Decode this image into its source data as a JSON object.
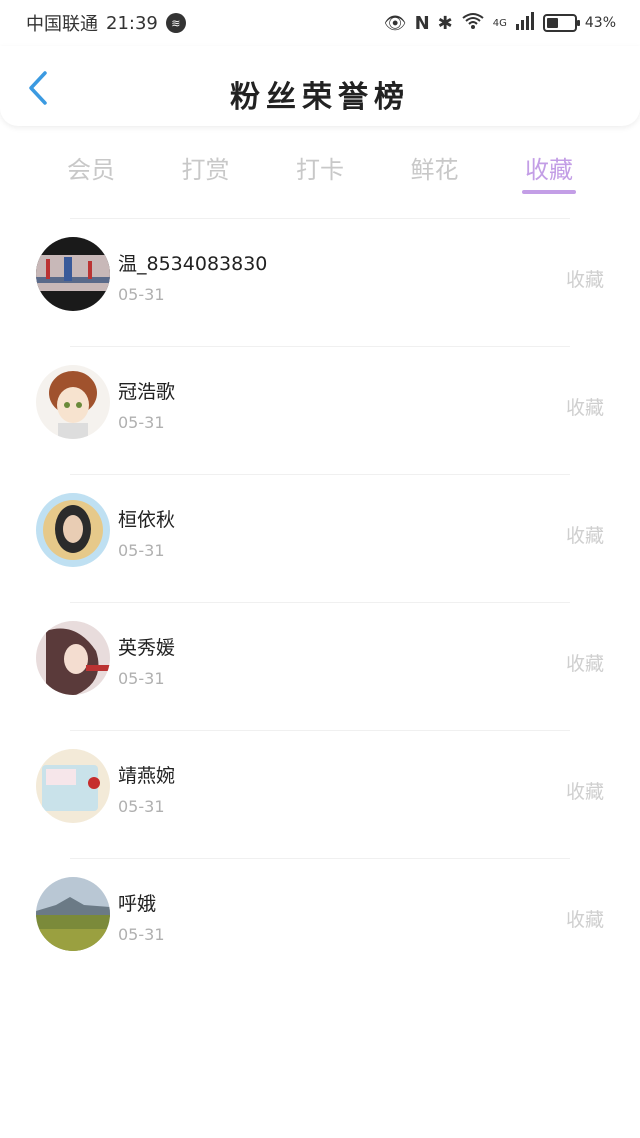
{
  "status_bar": {
    "carrier": "中国联通",
    "time": "21:39",
    "network": "4G",
    "battery": "43%",
    "battery_level": 0.43
  },
  "header": {
    "title": "粉丝荣誉榜"
  },
  "tabs": [
    {
      "label": "会员",
      "active": false
    },
    {
      "label": "打赏",
      "active": false
    },
    {
      "label": "打卡",
      "active": false
    },
    {
      "label": "鲜花",
      "active": false
    },
    {
      "label": "收藏",
      "active": true
    }
  ],
  "list": [
    {
      "name": "温_8534083830",
      "date": "05-31",
      "action": "收藏"
    },
    {
      "name": "冠浩歌",
      "date": "05-31",
      "action": "收藏"
    },
    {
      "name": "桓依秋",
      "date": "05-31",
      "action": "收藏"
    },
    {
      "name": "英秀媛",
      "date": "05-31",
      "action": "收藏"
    },
    {
      "name": "靖燕婉",
      "date": "05-31",
      "action": "收藏"
    },
    {
      "name": "呼娥",
      "date": "05-31",
      "action": "收藏"
    }
  ],
  "colors": {
    "accent": "#c39ee6",
    "back_arrow": "#3b9ae1",
    "tab_inactive": "#c8c8c8"
  }
}
